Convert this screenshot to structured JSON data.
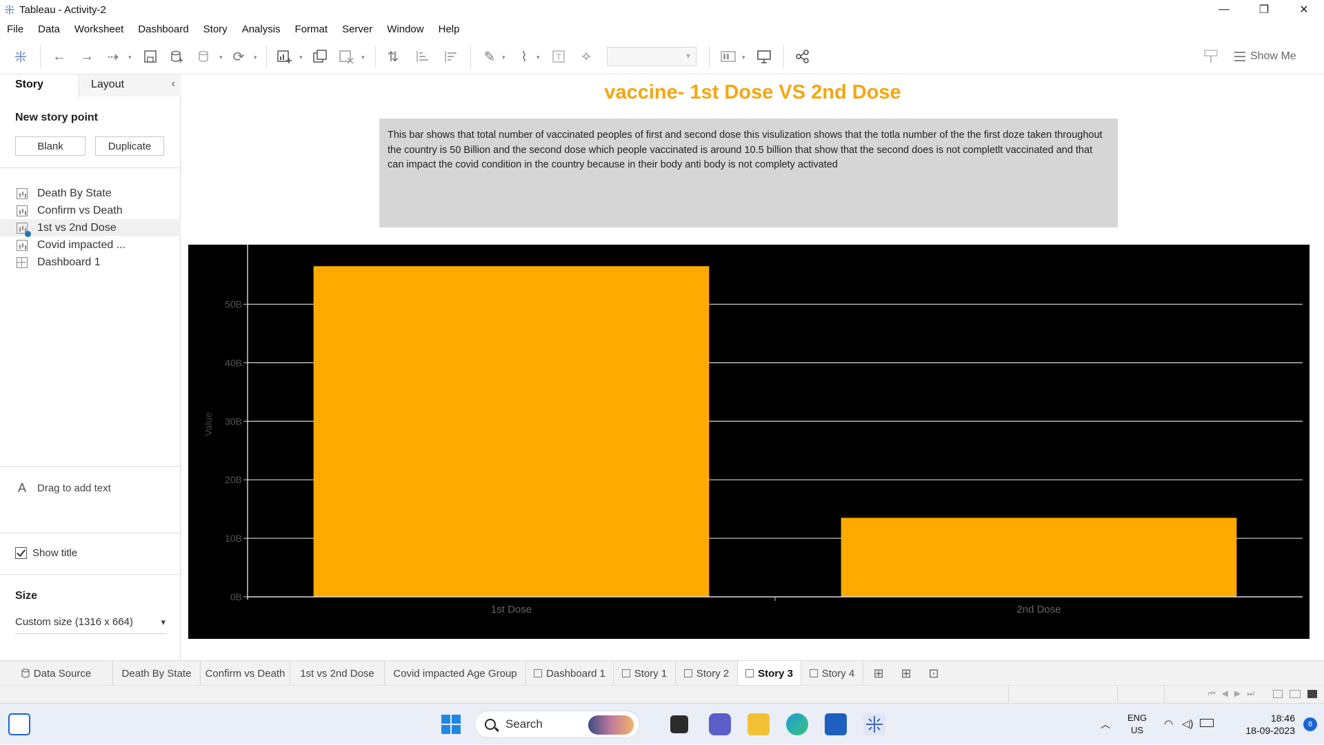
{
  "window": {
    "title": "Tableau - Activity-2",
    "minimize_glyph": "—",
    "restore_glyph": "❐",
    "close_glyph": "✕"
  },
  "menu": [
    "File",
    "Data",
    "Worksheet",
    "Dashboard",
    "Story",
    "Analysis",
    "Format",
    "Server",
    "Window",
    "Help"
  ],
  "toolbar": {
    "show_me_label": "Show Me"
  },
  "left_panel": {
    "tab_story": "Story",
    "tab_layout": "Layout",
    "collapse_glyph": "‹",
    "new_story_point_label": "New story point",
    "blank_button": "Blank",
    "duplicate_button": "Duplicate",
    "sheets": [
      {
        "label": "Death By State",
        "type": "chart",
        "active": false
      },
      {
        "label": "Confirm vs Death",
        "type": "chart",
        "active": false
      },
      {
        "label": "1st vs 2nd Dose",
        "type": "chart",
        "active": true
      },
      {
        "label": "Covid impacted ...",
        "type": "chart",
        "active": false
      },
      {
        "label": "Dashboard 1",
        "type": "dashboard",
        "active": false
      }
    ],
    "drag_text_glyph": "A",
    "drag_text_label": "Drag to add text",
    "show_title_label": "Show title",
    "show_title_checked": true,
    "size_label": "Size",
    "size_value": "Custom size (1316 x 664)"
  },
  "story": {
    "title": "vaccine- 1st Dose VS 2nd Dose",
    "caption": "This bar shows that total number of vaccinated peoples of first and second dose this visulization shows that the totla number of the the first doze taken throughout the country is 50 Billion and the second dose which people vaccinated is around 10.5 billion that show that the second does is not completlt vaccinated and that can impact the covid condition in the country because in their body anti body is not complety activated"
  },
  "chart_data": {
    "type": "bar",
    "title": "",
    "xlabel": "",
    "ylabel": "Value",
    "categories": [
      "1st Dose",
      "2nd Dose"
    ],
    "values": [
      56.5,
      13.5
    ],
    "ylim": [
      0,
      59
    ],
    "yticks": [
      0,
      10,
      20,
      30,
      40,
      50
    ],
    "ytick_labels": [
      "0B",
      "10B",
      "20B",
      "30B",
      "40B",
      "50B"
    ],
    "bar_color": "#FFAA00",
    "background": "#000000",
    "grid": true
  },
  "bottom_tabs": [
    {
      "label": "Data Source",
      "icon": "database-icon",
      "active": false
    },
    {
      "label": "Death By State",
      "icon": "",
      "active": false
    },
    {
      "label": "Confirm vs Death",
      "icon": "",
      "active": false
    },
    {
      "label": "1st vs 2nd Dose",
      "icon": "",
      "active": false
    },
    {
      "label": "Covid impacted Age Group",
      "icon": "",
      "active": false
    },
    {
      "label": "Dashboard 1",
      "icon": "dashboard-icon",
      "active": false
    },
    {
      "label": "Story 1",
      "icon": "story-icon",
      "active": false
    },
    {
      "label": "Story 2",
      "icon": "story-icon",
      "active": false
    },
    {
      "label": "Story 3",
      "icon": "story-icon",
      "active": true
    },
    {
      "label": "Story 4",
      "icon": "story-icon",
      "active": false
    }
  ],
  "taskbar": {
    "search_label": "Search",
    "lang_1": "ENG",
    "lang_2": "US",
    "time": "18:46",
    "date": "18-09-2023",
    "notification_count": "8"
  },
  "colors": {
    "title_accent": "#F5A511",
    "caption_bg": "#D6D6D6"
  }
}
